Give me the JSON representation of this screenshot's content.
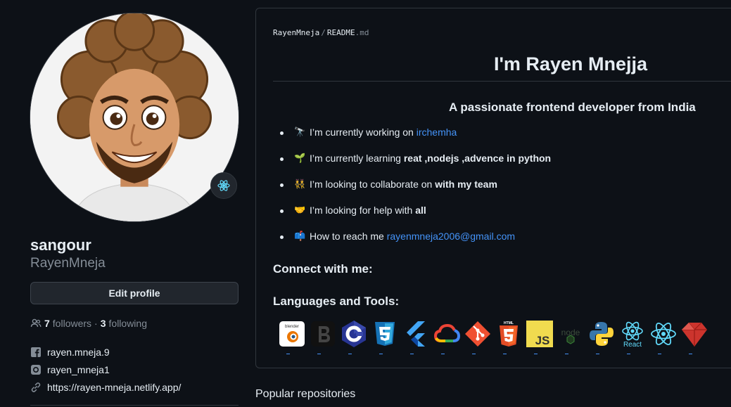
{
  "profile": {
    "name": "sangour",
    "login": "RayenMneja",
    "edit_label": "Edit profile",
    "followers_count": "7",
    "followers_label": "followers",
    "dot": "·",
    "following_count": "3",
    "following_label": "following",
    "facebook": "rayen.mneja.9",
    "instagram": "rayen_mneja1",
    "website": "https://rayen-mneja.netlify.app/"
  },
  "readme": {
    "crumb_user": "RayenMneja",
    "crumb_sep": "/",
    "crumb_file": "README",
    "crumb_ext": ".md",
    "title": "I'm Rayen Mnejja",
    "subtitle": "A passionate frontend developer from India",
    "bullets": [
      {
        "emoji": "🔭",
        "text": "I’m currently working on ",
        "link": "irchemha"
      },
      {
        "emoji": "🌱",
        "text": "I’m currently learning ",
        "bold": "reat ,nodejs ,advence in python"
      },
      {
        "emoji": "👯",
        "text": "I’m looking to collaborate on ",
        "bold": "with my team"
      },
      {
        "emoji": "🤝",
        "text": "I’m looking for help with ",
        "bold": "all"
      },
      {
        "emoji": "📫",
        "text": "How to reach me ",
        "link": "rayenmneja2006@gmail.com"
      }
    ],
    "connect_heading": "Connect with me:",
    "languages_heading": "Languages and Tools:",
    "tools": [
      "blender",
      "bootstrap",
      "c",
      "css3",
      "flutter",
      "gcp",
      "git",
      "html5",
      "javascript",
      "nodejs",
      "python",
      "react",
      "react",
      "ruby"
    ],
    "tool_texts": {
      "blender": "blender",
      "html": "HTML",
      "js": "JS",
      "node": "node",
      "react": "React"
    }
  },
  "popular": "Popular repositories",
  "colors": {
    "bg": "#0d1117",
    "border": "#30363d",
    "muted": "#848d97",
    "link": "#4493f8"
  }
}
